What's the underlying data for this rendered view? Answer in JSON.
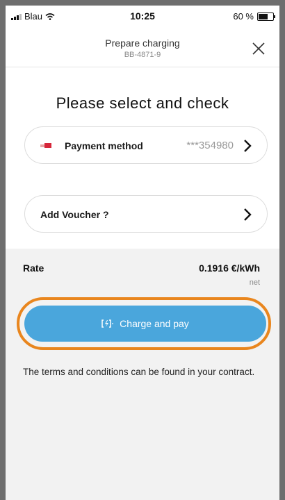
{
  "status_bar": {
    "carrier": "Blau",
    "time": "10:25",
    "battery": "60 %"
  },
  "nav": {
    "title": "Prepare charging",
    "subtitle": "BB-4871-9"
  },
  "heading": "Please select and check",
  "payment": {
    "label": "Payment method",
    "value": "***354980"
  },
  "voucher": {
    "label": "Add Voucher ?"
  },
  "rate": {
    "label": "Rate",
    "value": "0.1916 €/kWh",
    "note": "net"
  },
  "cta": {
    "label": "Charge and pay"
  },
  "terms": "The terms and conditions can be found in your contract.",
  "colors": {
    "cta": "#4aa6dc",
    "highlight": "#e9861e",
    "card_brand": "#d6263a"
  }
}
